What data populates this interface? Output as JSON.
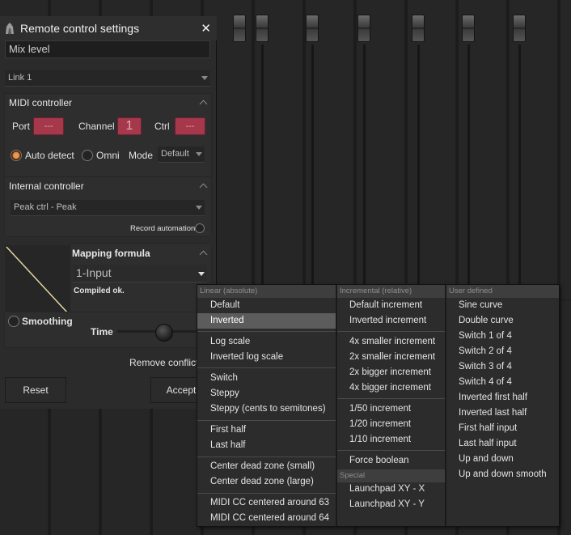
{
  "dialog": {
    "title": "Remote control settings",
    "close": "✕",
    "name_value": "Mix level",
    "link_select": "Link 1"
  },
  "midi": {
    "title": "MIDI controller",
    "port_label": "Port",
    "port_value": "---",
    "channel_label": "Channel",
    "channel_value": "1",
    "ctrl_label": "Ctrl",
    "ctrl_value": "---",
    "auto_detect": "Auto detect",
    "omni": "Omni",
    "mode_label": "Mode",
    "mode_value": "Default"
  },
  "internal": {
    "title": "Internal controller",
    "select": "Peak ctrl - Peak",
    "record_automation": "Record automation"
  },
  "mapping": {
    "title": "Mapping formula",
    "value": "1-Input",
    "status": "Compiled ok."
  },
  "smoothing": {
    "label": "Smoothing",
    "time_label": "Time"
  },
  "remove_conflicts": "Remove conflicts",
  "buttons": {
    "reset": "Reset",
    "accept": "Accept"
  },
  "menu": {
    "linear": {
      "header": "Linear (absolute)",
      "items": [
        "Default",
        "Inverted",
        "Log scale",
        "Inverted log scale",
        "Switch",
        "Steppy",
        "Steppy (cents to semitones)",
        "First half",
        "Last half",
        "Center dead zone (small)",
        "Center dead zone (large)",
        "MIDI CC centered around 63",
        "MIDI CC centered around 64"
      ]
    },
    "incremental": {
      "header": "Incremental (relative)",
      "items": [
        "Default increment",
        "Inverted increment",
        "4x smaller increment",
        "2x smaller increment",
        "2x bigger increment",
        "4x bigger increment",
        "1/50 increment",
        "1/20 increment",
        "1/10 increment",
        "Force boolean"
      ]
    },
    "special": {
      "header": "Special",
      "items": [
        "Launchpad XY - X",
        "Launchpad XY - Y"
      ]
    },
    "user": {
      "header": "User defined",
      "items": [
        "Sine curve",
        "Double curve",
        "Switch 1 of 4",
        "Switch 2 of 4",
        "Switch 3 of 4",
        "Switch 4 of 4",
        "Inverted first half",
        "Inverted last half",
        "First half input",
        "Last half input",
        "Up and down",
        "Up and down smooth"
      ]
    },
    "selected": "Inverted"
  },
  "colors": {
    "accent_red": "#a5384a",
    "radio_on": "#e08a40",
    "selection": "#5c5c5c"
  }
}
